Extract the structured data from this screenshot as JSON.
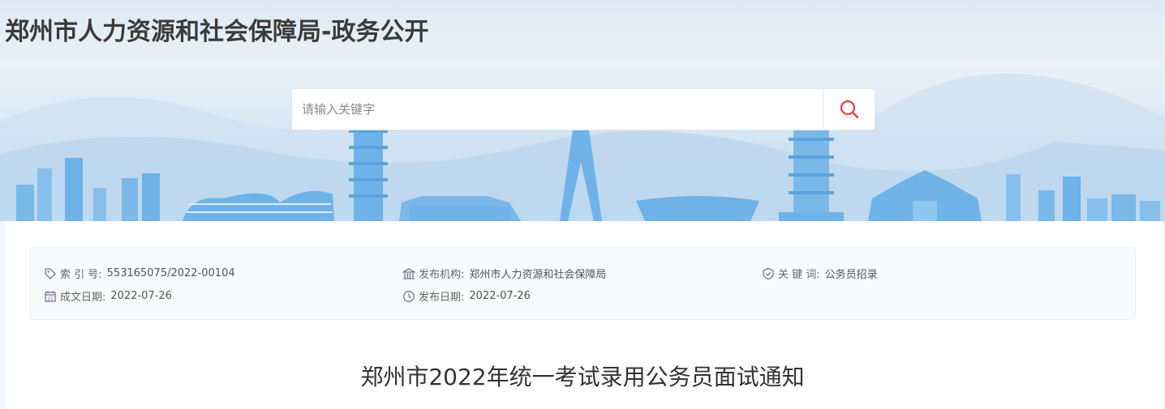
{
  "header": {
    "site_title": "郑州市人力资源和社会保障局-政务公开"
  },
  "search": {
    "placeholder": "请输入关键字",
    "value": "",
    "button_icon": "search-icon"
  },
  "meta": {
    "index_label": "索  引  号:",
    "index_value": "553165075/2022-00104",
    "publisher_label": "发布机构:",
    "publisher_value": "郑州市人力资源和社会保障局",
    "keyword_label": "关  键  词:",
    "keyword_value": "公务员招录",
    "created_label": "成文日期:",
    "created_value": "2022-07-26",
    "published_label": "发布日期:",
    "published_value": "2022-07-26"
  },
  "article": {
    "title": "郑州市2022年统一考试录用公务员面试通知"
  },
  "colors": {
    "accent": "#e8413f",
    "skyline": "#6fb2e8",
    "title": "#3b3b3b"
  }
}
